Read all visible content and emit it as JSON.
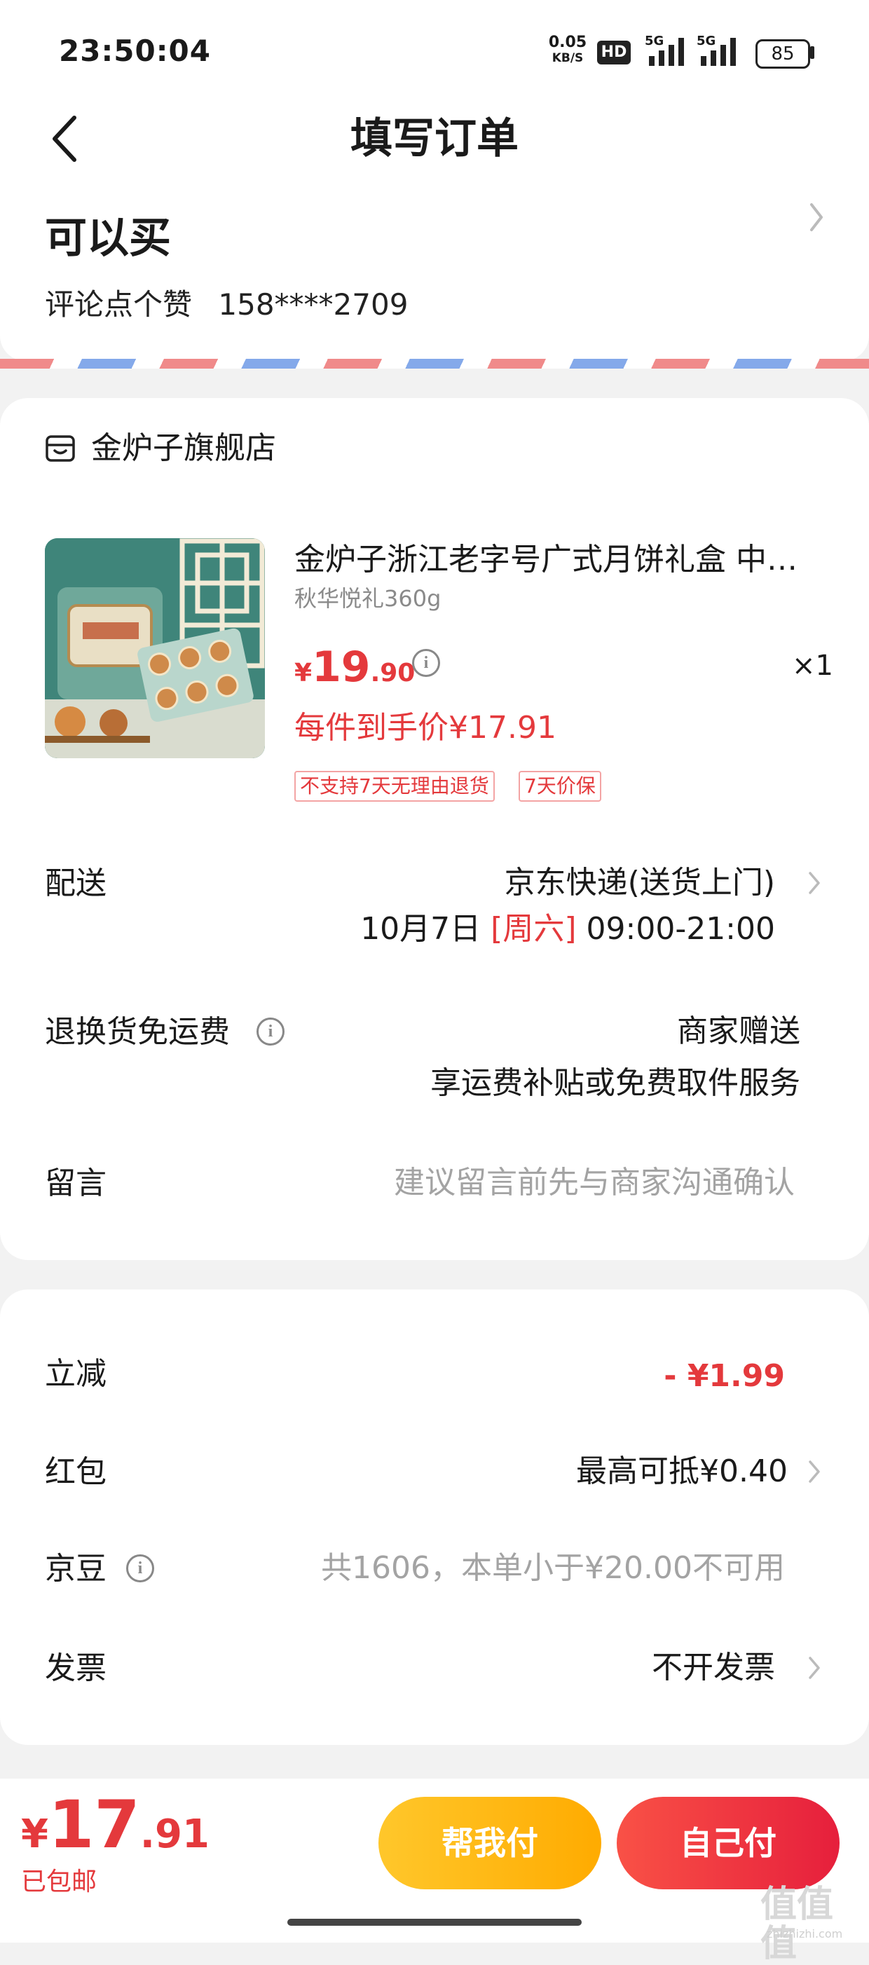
{
  "status_bar": {
    "time": "23:50:04",
    "net_speed_value": "0.05",
    "net_speed_unit": "KB/S",
    "hd_label": "HD",
    "signal1_label": "5G",
    "signal2_label": "5G",
    "battery": "85"
  },
  "nav": {
    "title": "填写订单"
  },
  "address": {
    "name": "可以买",
    "contact": "评论点个赞",
    "phone": "158****2709"
  },
  "shop": {
    "name": "金炉子旗舰店"
  },
  "product": {
    "title": "金炉子浙江老字号广式月饼礼盒 中…",
    "spec": "秋华悦礼360g",
    "price_currency": "¥",
    "price_int": "19",
    "price_dec": ".90",
    "quantity": "×1",
    "unit_price": "每件到手价¥17.91",
    "tags": [
      "不支持7天无理由退货",
      "7天价保"
    ]
  },
  "delivery": {
    "label": "配送",
    "method": "京东快递(送货上门)",
    "date": "10月7日",
    "weekday": "[周六]",
    "time_window": "09:00-21:00"
  },
  "return_shipping": {
    "label": "退换货免运费",
    "value": "商家赠送",
    "desc": "享运费补贴或免费取件服务"
  },
  "message": {
    "label": "留言",
    "placeholder": "建议留言前先与商家沟通确认"
  },
  "discounts": {
    "instant": {
      "label": "立减",
      "value": "- ¥1.99"
    },
    "red_packet": {
      "label": "红包",
      "value": "最高可抵¥0.40"
    },
    "jingdou": {
      "label": "京豆",
      "value": "共1606，本单小于¥20.00不可用"
    },
    "invoice": {
      "label": "发票",
      "value": "不开发票"
    }
  },
  "footer": {
    "total_currency": "¥",
    "total_int": "17",
    "total_dec": ".91",
    "shipping_note": "已包邮",
    "help_pay_label": "帮我付",
    "self_pay_label": "自己付"
  },
  "watermark": {
    "text": "值值值",
    "sub": "zhizhizhi.com"
  },
  "colors": {
    "accent_red": "#e4393c",
    "help_btn": "#ffb400",
    "self_btn": "#ef3340",
    "background": "#f2f2f2"
  }
}
